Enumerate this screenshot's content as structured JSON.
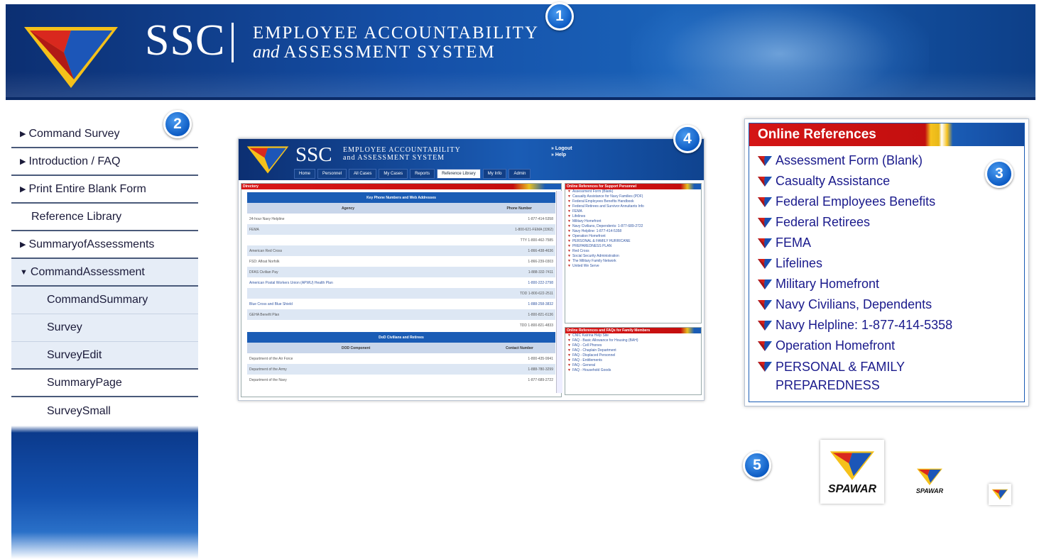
{
  "header": {
    "brand": "SSC",
    "system_line1": "EMPLOYEE ACCOUNTABILITY",
    "system_line2_italic": "and",
    "system_line2": "ASSESSMENT SYSTEM",
    "colors": {
      "banner_dark": "#0c2f72",
      "banner_light": "#1a62b8"
    }
  },
  "callouts": [
    "1",
    "2",
    "3",
    "4",
    "5"
  ],
  "sidebar": {
    "items": [
      {
        "label": "Command Survey",
        "arrow": "▶"
      },
      {
        "label": "Introduction / FAQ",
        "arrow": "▶"
      },
      {
        "label": "Print Entire Blank Form",
        "arrow": "▶"
      },
      {
        "label": "Reference Library",
        "arrow": ""
      },
      {
        "label": "SummaryofAssessments",
        "arrow": "▶"
      },
      {
        "label": "CommandAssessment",
        "arrow": "▼"
      },
      {
        "label": "CommandSummary"
      },
      {
        "label": "Survey"
      },
      {
        "label": "SurveyEdit"
      },
      {
        "label": "SummaryPage"
      },
      {
        "label": "SurveySmall"
      }
    ]
  },
  "screenshot": {
    "brand": "SSC",
    "line1": "EMPLOYEE ACCOUNTABILITY",
    "line2": "and ASSESSMENT SYSTEM",
    "logout": "» Logout",
    "help": "» Help",
    "tabs": [
      "Home",
      "Personnel",
      "All Cases",
      "My Cases",
      "Reports",
      "Reference Library",
      "My Info",
      "Admin"
    ],
    "left_bar": "Directory",
    "table1_title": "Key Phone Numbers and Web Addresses",
    "table1_cols": [
      "Agency",
      "Phone Number"
    ],
    "table1_rows": [
      [
        "24-hour Navy Helpline",
        "1-877-414-5358"
      ],
      [
        "FEMA",
        "1-800-621-FEMA (3362)"
      ],
      [
        "",
        "TTY 1-800-462-7585"
      ],
      [
        "American Red Cross",
        "1-866-438-4636"
      ],
      [
        "FSD: Afloat Norfolk",
        "1-866-239-0303"
      ],
      [
        "DFAS Civilian Pay",
        "1-888-332-7411"
      ],
      [
        "American Postal Workers Union (APWU) Health Plan",
        "1-800-222-2798"
      ],
      [
        "",
        "TDD 1-800-622-2511"
      ],
      [
        "Blue Cross and Blue Shield",
        "1-888-258-3832"
      ],
      [
        "GEHA Benefit Plan",
        "1-800-821-6136"
      ],
      [
        "",
        "TDD 1-800-821-4833"
      ]
    ],
    "table2_title": "DoD Civilians and Retirees",
    "table2_cols": [
      "DOD Component",
      "Contact Number"
    ],
    "table2_rows": [
      [
        "Department of the Air Force",
        "1-800-435-9941"
      ],
      [
        "Department of the Army",
        "1-888-780-3299"
      ],
      [
        "Department of the Navy",
        "1-877-689-2722"
      ]
    ],
    "right_bar1": "Online References for Support Personnel",
    "right_list1": [
      "Assessment Form (Blank)",
      "Casualty Assistance for Navy Families (PDF)",
      "Federal Employees Benefits Handbook",
      "Federal Retirees and Survivor Annuitants Info",
      "FEMA",
      "Lifelines",
      "Military Homefront",
      "Navy Civilians, Dependents: 1-877-689-2722",
      "Navy Helpline: 1-877-414-5358",
      "Operation Homefront",
      "PERSONAL & FAMILY HURRICANE",
      "PREPAREDNESS PLAN",
      "Red Cross",
      "Social Security Administration",
      "The Military Family Network",
      "United We Serve"
    ],
    "right_bar2": "Online References and FAQs for Family Members",
    "right_list2": [
      "CNIC Katrina Help Site",
      "FAQ - Basic Allowance for Housing (BAH)",
      "FAQ - Cell Phones",
      "FAQ - Chaplain Department",
      "FAQ - Displaced Personnel",
      "FAQ - Entitlements",
      "FAQ - General",
      "FAQ - Household Goods"
    ]
  },
  "references": {
    "title": "Online References",
    "items": [
      "Assessment Form (Blank)",
      "Casualty Assistance",
      "Federal Employees Benefits",
      "Federal Retirees",
      "FEMA",
      "Lifelines",
      "Military Homefront",
      "Navy Civilians, Dependents",
      "Navy Helpline: 1-877-414-5358",
      "Operation Homefront",
      "PERSONAL & FAMILY PREPAREDNESS"
    ],
    "colors": {
      "title_red": "#d41515",
      "link_blue": "#1a1a8c",
      "stripe_gold": "#f6c21e"
    }
  },
  "logos": {
    "word": "SPAWAR"
  }
}
